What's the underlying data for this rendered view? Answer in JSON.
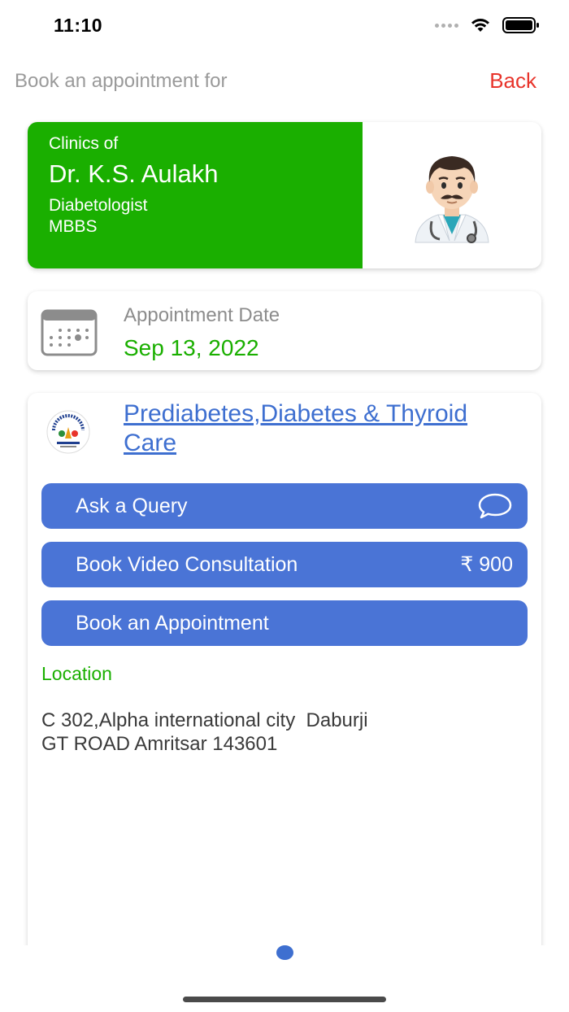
{
  "status_bar": {
    "time": "11:10"
  },
  "header": {
    "title": "Book an appointment for",
    "back_label": "Back"
  },
  "doctor": {
    "clinic_prefix": "Clinics of",
    "name": "Dr. K.S. Aulakh",
    "specialty": "Diabetologist",
    "degree": "MBBS",
    "avatar_icon": "doctor-emoji-icon"
  },
  "appointment": {
    "label": "Appointment Date",
    "date": "Sep 13, 2022"
  },
  "clinic": {
    "name": "Prediabetes,Diabetes & Thyroid Care",
    "actions": [
      {
        "label": "Ask a Query",
        "icon": "chat-bubble-icon"
      },
      {
        "label": "Book Video Consultation",
        "price": "₹ 900"
      },
      {
        "label": "Book an Appointment"
      }
    ],
    "location_title": "Location",
    "address_lines": [
      "C 302,Alpha international city  Daburji",
      "GT ROAD Amritsar 143601"
    ]
  },
  "colors": {
    "green": "#1aaf00",
    "button_blue": "#4a74d6",
    "link_blue": "#3e6fd0",
    "back_red": "#e8342b"
  }
}
